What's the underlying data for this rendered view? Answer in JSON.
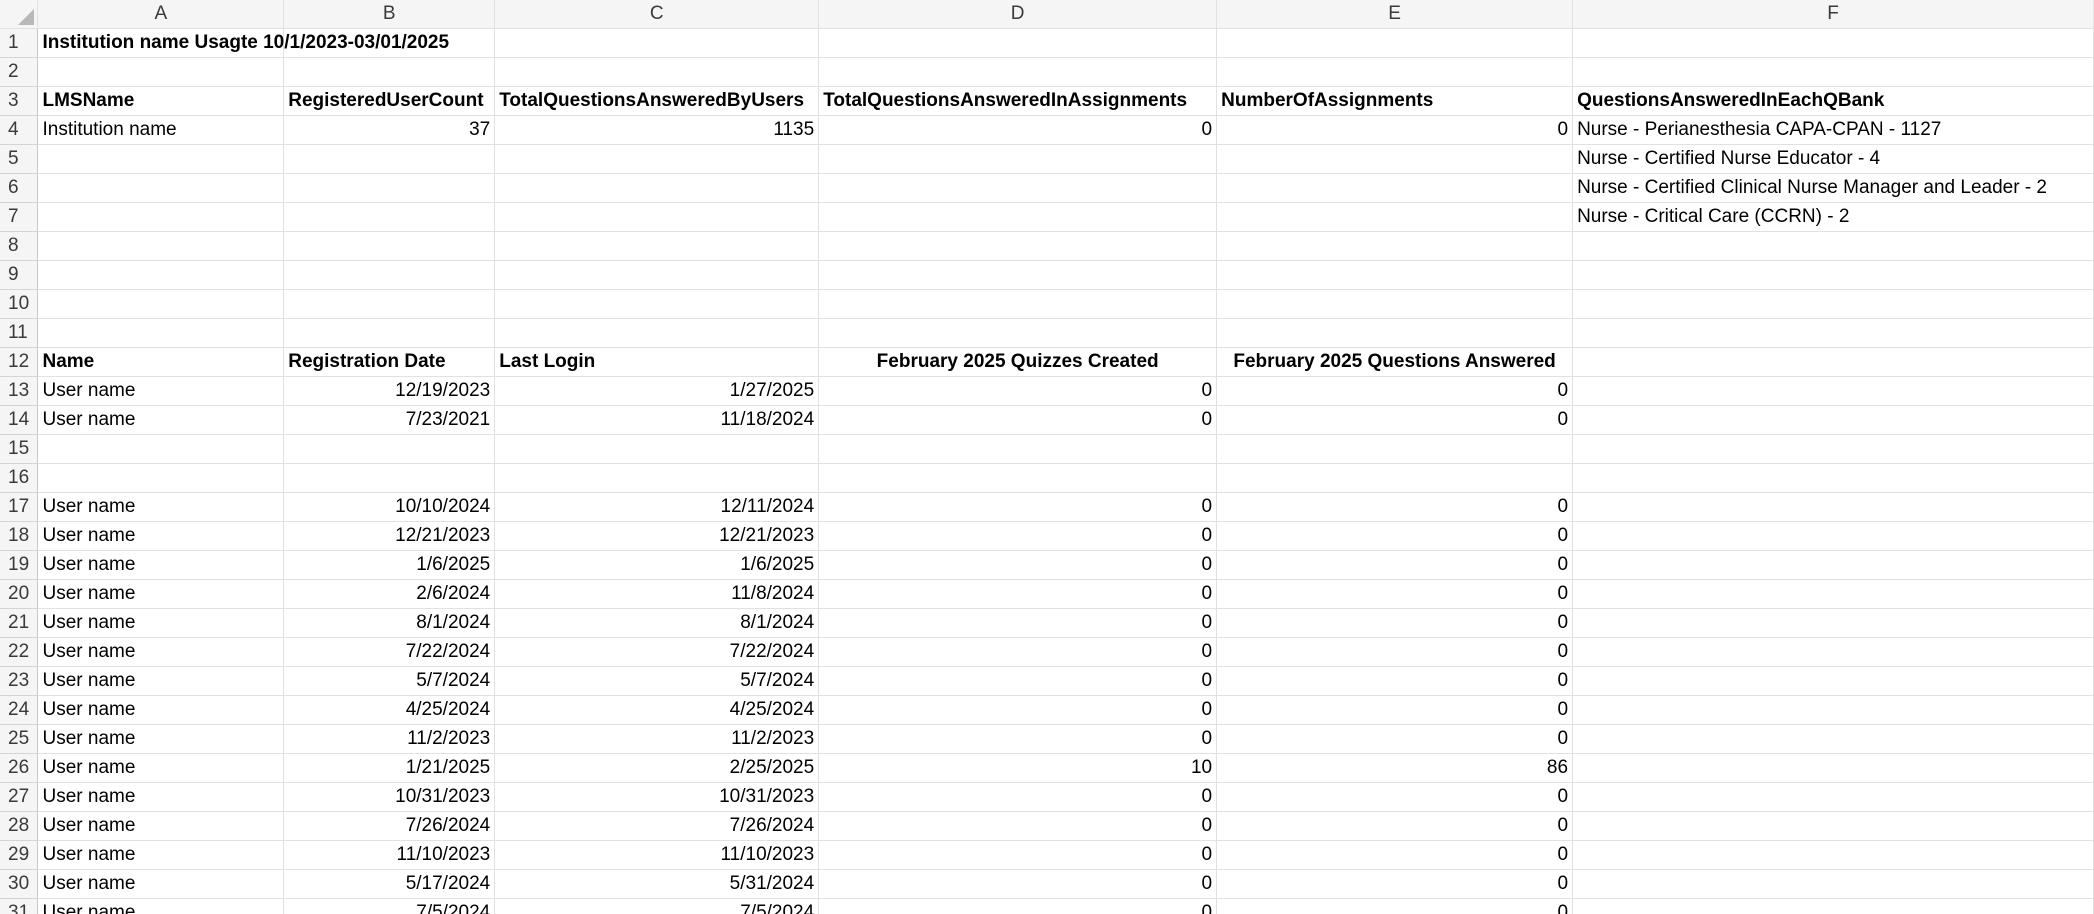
{
  "columns": [
    "A",
    "B",
    "C",
    "D",
    "E",
    "F"
  ],
  "rows": [
    {
      "n": "1",
      "cells": {
        "A": "Institution name Usagte 10/1/2023-03/01/2025"
      }
    },
    {
      "n": "2",
      "cells": {}
    },
    {
      "n": "3",
      "cells": {
        "A": "LMSName",
        "B": "RegisteredUserCount",
        "C": "TotalQuestionsAnsweredByUsers",
        "D": "TotalQuestionsAnsweredInAssignments",
        "E": "NumberOfAssignments",
        "F": "QuestionsAnsweredInEachQBank"
      }
    },
    {
      "n": "4",
      "cells": {
        "A": "Institution name",
        "B": "37",
        "C": "1135",
        "D": "0",
        "E": "0",
        "F": "Nurse - Perianesthesia CAPA-CPAN - 1127"
      }
    },
    {
      "n": "5",
      "cells": {
        "F": "Nurse - Certified Nurse Educator - 4"
      }
    },
    {
      "n": "6",
      "cells": {
        "F": "Nurse - Certified Clinical Nurse Manager and Leader - 2"
      }
    },
    {
      "n": "7",
      "cells": {
        "F": "Nurse - Critical Care (CCRN) - 2"
      }
    },
    {
      "n": "8",
      "cells": {}
    },
    {
      "n": "9",
      "cells": {}
    },
    {
      "n": "10",
      "cells": {}
    },
    {
      "n": "11",
      "cells": {}
    },
    {
      "n": "12",
      "cells": {
        "A": "Name",
        "B": "Registration Date",
        "C": "Last Login",
        "D": "February 2025 Quizzes Created",
        "E": "February 2025 Questions Answered"
      }
    },
    {
      "n": "13",
      "cells": {
        "A": "User name",
        "B": "12/19/2023",
        "C": "1/27/2025",
        "D": "0",
        "E": "0"
      }
    },
    {
      "n": "14",
      "cells": {
        "A": "User name",
        "B": "7/23/2021",
        "C": "11/18/2024",
        "D": "0",
        "E": "0"
      }
    },
    {
      "n": "15",
      "cells": {}
    },
    {
      "n": "16",
      "cells": {}
    },
    {
      "n": "17",
      "cells": {
        "A": "User name",
        "B": "10/10/2024",
        "C": "12/11/2024",
        "D": "0",
        "E": "0"
      }
    },
    {
      "n": "18",
      "cells": {
        "A": "User name",
        "B": "12/21/2023",
        "C": "12/21/2023",
        "D": "0",
        "E": "0"
      }
    },
    {
      "n": "19",
      "cells": {
        "A": "User name",
        "B": "1/6/2025",
        "C": "1/6/2025",
        "D": "0",
        "E": "0"
      }
    },
    {
      "n": "20",
      "cells": {
        "A": "User name",
        "B": "2/6/2024",
        "C": "11/8/2024",
        "D": "0",
        "E": "0"
      }
    },
    {
      "n": "21",
      "cells": {
        "A": "User name",
        "B": "8/1/2024",
        "C": "8/1/2024",
        "D": "0",
        "E": "0"
      }
    },
    {
      "n": "22",
      "cells": {
        "A": "User name",
        "B": "7/22/2024",
        "C": "7/22/2024",
        "D": "0",
        "E": "0"
      }
    },
    {
      "n": "23",
      "cells": {
        "A": "User name",
        "B": "5/7/2024",
        "C": "5/7/2024",
        "D": "0",
        "E": "0"
      }
    },
    {
      "n": "24",
      "cells": {
        "A": "User name",
        "B": "4/25/2024",
        "C": "4/25/2024",
        "D": "0",
        "E": "0"
      }
    },
    {
      "n": "25",
      "cells": {
        "A": "User name",
        "B": "11/2/2023",
        "C": "11/2/2023",
        "D": "0",
        "E": "0"
      }
    },
    {
      "n": "26",
      "cells": {
        "A": "User name",
        "B": "1/21/2025",
        "C": "2/25/2025",
        "D": "10",
        "E": "86"
      }
    },
    {
      "n": "27",
      "cells": {
        "A": "User name",
        "B": "10/31/2023",
        "C": "10/31/2023",
        "D": "0",
        "E": "0"
      }
    },
    {
      "n": "28",
      "cells": {
        "A": "User name",
        "B": "7/26/2024",
        "C": "7/26/2024",
        "D": "0",
        "E": "0"
      }
    },
    {
      "n": "29",
      "cells": {
        "A": "User name",
        "B": "11/10/2023",
        "C": "11/10/2023",
        "D": "0",
        "E": "0"
      }
    },
    {
      "n": "30",
      "cells": {
        "A": "User name",
        "B": "5/17/2024",
        "C": "5/31/2024",
        "D": "0",
        "E": "0"
      }
    },
    {
      "n": "31",
      "cells": {
        "A": "User name",
        "B": "7/5/2024",
        "C": "7/5/2024",
        "D": "0",
        "E": "0"
      }
    }
  ]
}
